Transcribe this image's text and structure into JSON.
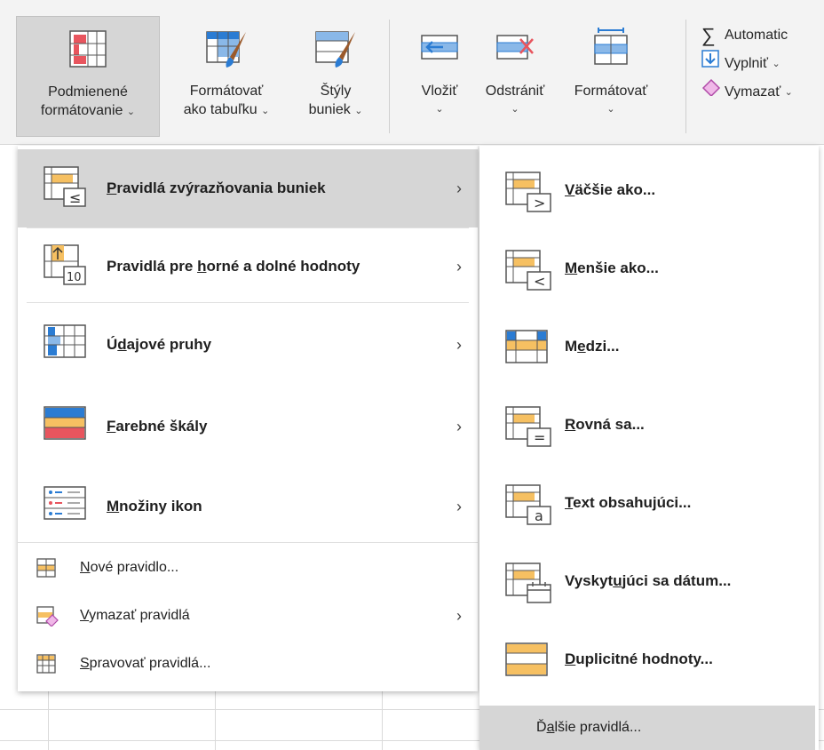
{
  "ribbon": {
    "conditional": {
      "line1": "Podmienené",
      "line2": "formátovanie"
    },
    "format_table": {
      "line1": "Formátovať",
      "line2": "ako tabuľku"
    },
    "cell_styles": {
      "line1": "Štýly",
      "line2": "buniek"
    },
    "insert": {
      "line1": "Vložiť"
    },
    "delete": {
      "line1": "Odstrániť"
    },
    "format": {
      "line1": "Formátovať"
    },
    "autosum": "Automatic",
    "fill": "Vyplniť",
    "clear": "Vymazať"
  },
  "menu": {
    "highlight": {
      "pre": "",
      "u": "P",
      "post": "ravidlá zvýrazňovania buniek"
    },
    "topbottom": {
      "pre": "Pravidlá pre ",
      "u": "h",
      "post": "orné a dolné hodnoty"
    },
    "databars": {
      "pre": "Ú",
      "u": "d",
      "post": "ajové pruhy"
    },
    "colorscales": {
      "pre": "",
      "u": "F",
      "post": "arebné škály"
    },
    "iconsets": {
      "pre": "",
      "u": "M",
      "post": "nožiny ikon"
    },
    "newrule": {
      "pre": "",
      "u": "N",
      "post": "ové pravidlo..."
    },
    "clearrules": {
      "pre": "",
      "u": "V",
      "post": "ymazať pravidlá"
    },
    "managerules": {
      "pre": "",
      "u": "S",
      "post": "pravovať pravidlá..."
    }
  },
  "submenu": {
    "greater": {
      "pre": "",
      "u": "V",
      "post": "äčšie ako..."
    },
    "less": {
      "pre": "",
      "u": "M",
      "post": "enšie ako..."
    },
    "between": {
      "pre": "M",
      "u": "e",
      "post": "dzi..."
    },
    "equal": {
      "pre": "",
      "u": "R",
      "post": "ovná sa..."
    },
    "text": {
      "pre": "",
      "u": "T",
      "post": "ext obsahujúci..."
    },
    "date": {
      "pre": "Vyskyt",
      "u": "u",
      "post": "júci sa dátum..."
    },
    "duplicate": {
      "pre": "",
      "u": "D",
      "post": "uplicitné hodnoty..."
    },
    "more": {
      "pre": "Ď",
      "u": "a",
      "post": "lšie pravidlá..."
    }
  },
  "symbols": {
    "chevron_down": "⌄",
    "arrow_right": "›",
    "sigma": "∑"
  },
  "colors": {
    "accent": "#2b7cd3",
    "highlight_bg": "#d6d6d6",
    "orange": "#f6c062",
    "red": "#e8555e"
  }
}
